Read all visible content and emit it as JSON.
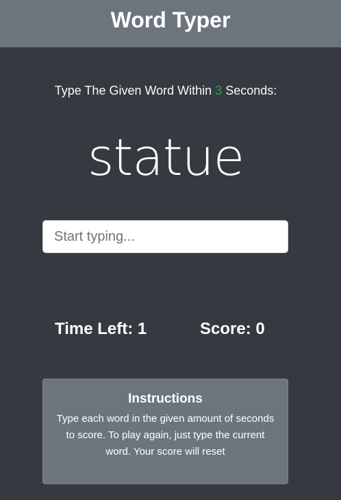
{
  "header": {
    "title": "Word Typer"
  },
  "prompt": {
    "before": "Type The Given Word Within ",
    "seconds": "3",
    "after": " Seconds:"
  },
  "game": {
    "current_word": "statue",
    "input_placeholder": "Start typing...",
    "input_value": "",
    "time_label": "Time Left:",
    "time_value": "1",
    "score_label": "Score:",
    "score_value": "0"
  },
  "instructions": {
    "title": "Instructions",
    "text": "Type each word in the given amount of seconds to score. To play again, just type the current word. Your score will reset"
  },
  "colors": {
    "background": "#343a40",
    "header": "#6c757d",
    "accent_seconds": "#28a745"
  }
}
